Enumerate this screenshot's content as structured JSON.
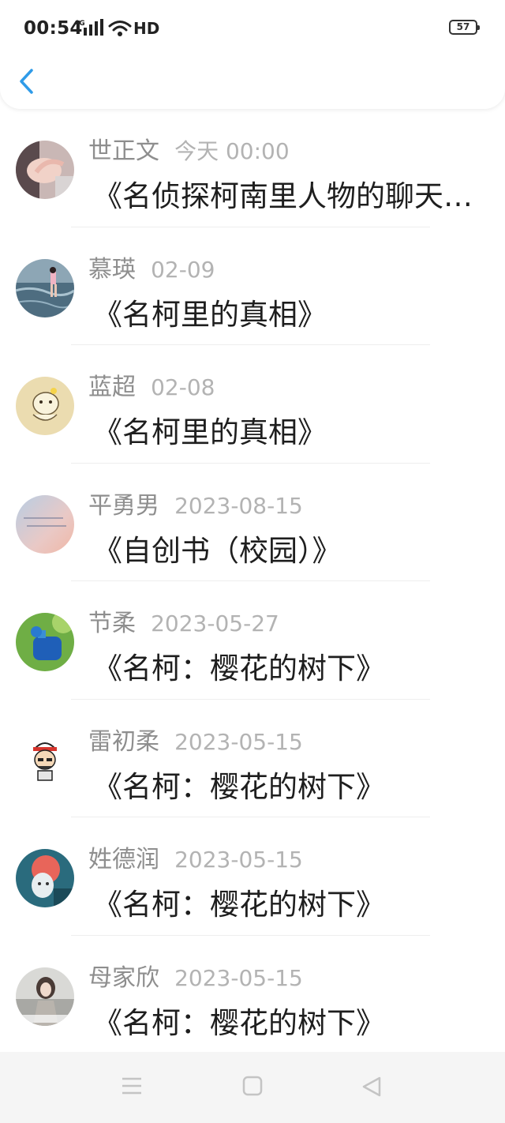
{
  "status_bar": {
    "time": "00:54",
    "network": "4G",
    "hd": "HD",
    "battery": "57"
  },
  "header": {
    "back_icon": "chevron-left-icon",
    "accent_color": "#2f9be8"
  },
  "items": [
    {
      "name": "世正文",
      "date": "今天 00:00",
      "title": "《名侦探柯南里人物的聊天群》"
    },
    {
      "name": "慕瑛",
      "date": "02-09",
      "title": "《名柯里的真相》"
    },
    {
      "name": "蓝超",
      "date": "02-08",
      "title": "《名柯里的真相》"
    },
    {
      "name": "平勇男",
      "date": "2023-08-15",
      "title": "《自创书（校园）》"
    },
    {
      "name": "节柔",
      "date": "2023-05-27",
      "title": "《名柯：樱花的树下》"
    },
    {
      "name": "雷初柔",
      "date": "2023-05-15",
      "title": "《名柯：樱花的树下》"
    },
    {
      "name": "姓德润",
      "date": "2023-05-15",
      "title": "《名柯：樱花的树下》"
    },
    {
      "name": "母家欣",
      "date": "2023-05-15",
      "title": "《名柯：樱花的树下》"
    }
  ],
  "nav_bar": {
    "menu_icon": "menu-icon",
    "home_icon": "home-square-icon",
    "back_icon": "back-triangle-icon"
  }
}
